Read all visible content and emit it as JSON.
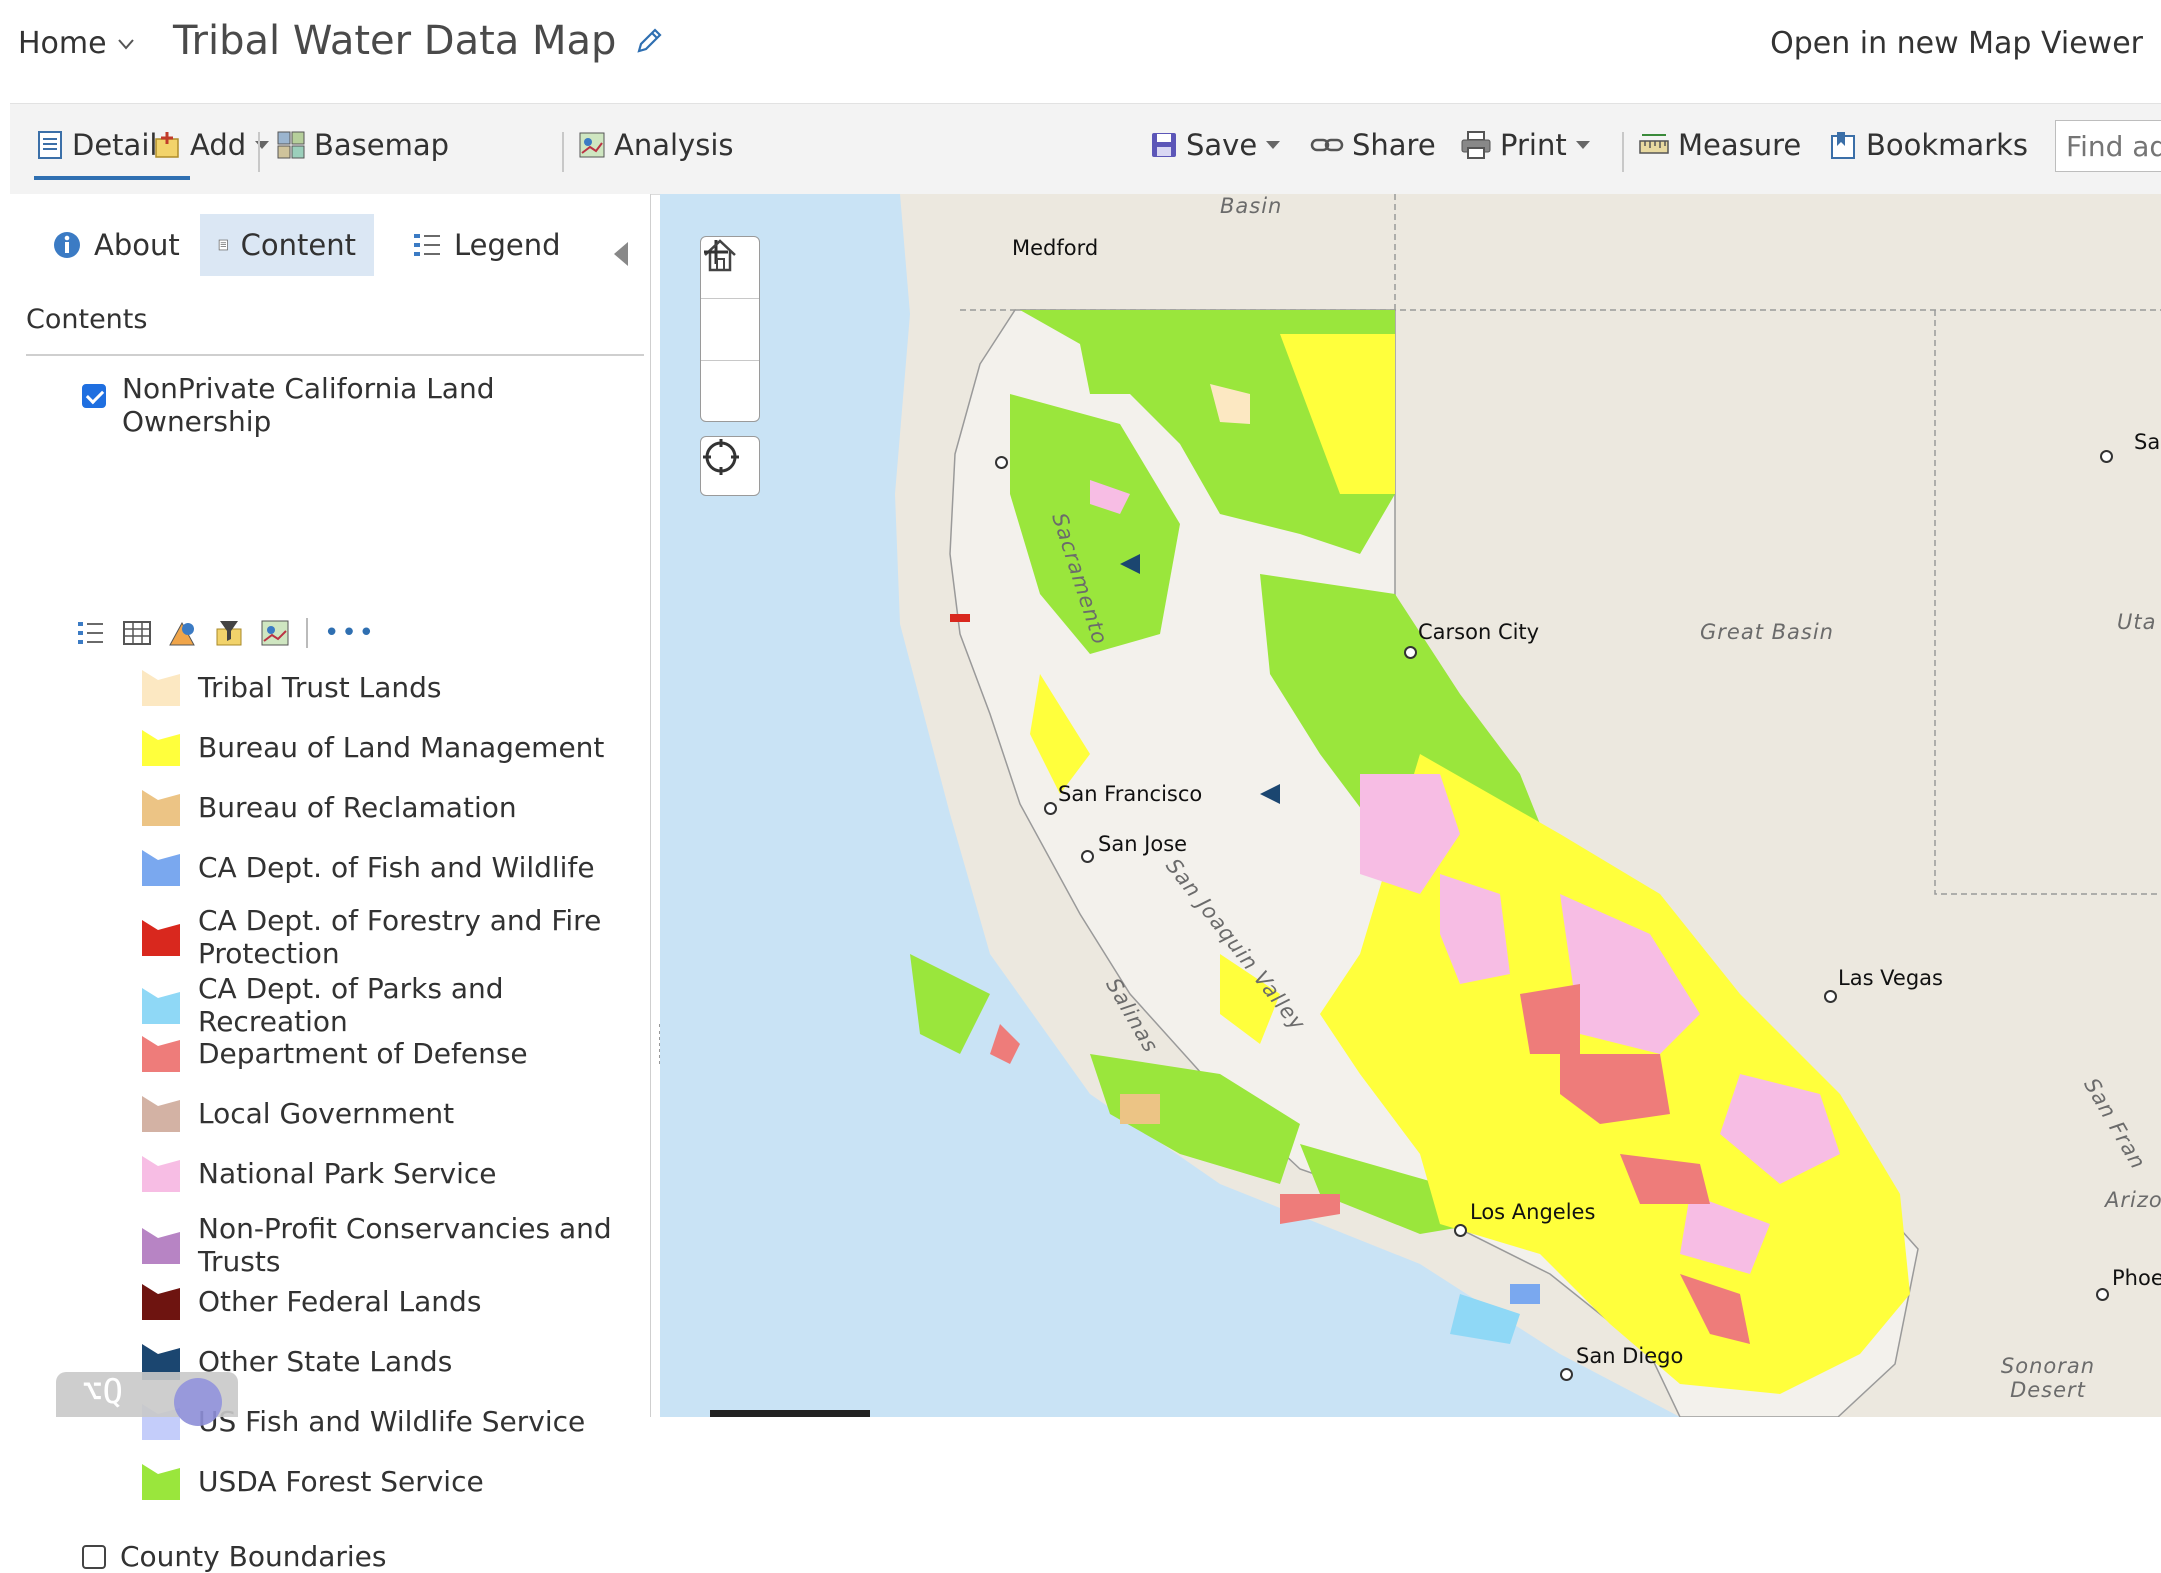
{
  "header": {
    "home_label": "Home",
    "title": "Tribal Water Data Map",
    "open_viewer_label": "Open in new Map Viewer"
  },
  "toolbar": {
    "details": "Details",
    "add": "Add",
    "basemap": "Basemap",
    "analysis": "Analysis",
    "save": "Save",
    "share": "Share",
    "print": "Print",
    "measure": "Measure",
    "bookmarks": "Bookmarks",
    "find_placeholder": "Find add"
  },
  "sidebar": {
    "tabs": [
      "About",
      "Content",
      "Legend"
    ],
    "active_tab": "Content",
    "contents_title": "Contents",
    "layers": [
      {
        "name": "NonPrivate California Land Ownership",
        "checked": true
      },
      {
        "name": "County Boundaries",
        "checked": false
      }
    ],
    "legend": [
      {
        "label": "Tribal Trust Lands",
        "color": "#fce8c2"
      },
      {
        "label": "Bureau of Land Management",
        "color": "#ffff3c"
      },
      {
        "label": "Bureau of Reclamation",
        "color": "#ecc485"
      },
      {
        "label": "CA Dept. of Fish and Wildlife",
        "color": "#7aa8ef"
      },
      {
        "label": "CA Dept. of Forestry and Fire Protection",
        "color": "#d9281e"
      },
      {
        "label": "CA Dept. of Parks and Recreation",
        "color": "#8fd8f6"
      },
      {
        "label": "Department of Defense",
        "color": "#ee7c7a"
      },
      {
        "label": "Local Government",
        "color": "#d3b2a4"
      },
      {
        "label": "National Park Service",
        "color": "#f7bde4"
      },
      {
        "label": "Non-Profit Conservancies and Trusts",
        "color": "#b784c4"
      },
      {
        "label": "Other Federal Lands",
        "color": "#6e1410"
      },
      {
        "label": "Other State Lands",
        "color": "#1b4670"
      },
      {
        "label": "US Fish and Wildlife Service",
        "color": "#c4cdfa"
      },
      {
        "label": "USDA Forest Service",
        "color": "#9ae63c"
      }
    ],
    "badge_text": "⌥Q"
  },
  "map": {
    "cities": [
      "Medford",
      "Carson City",
      "San Francisco",
      "San Jose",
      "Las Vegas",
      "Los Angeles",
      "San Diego",
      "Sal",
      "Phoe"
    ],
    "regions": [
      "Basin",
      "Great Basin",
      "Sacramento",
      "San Joaquin Valley",
      "Salinas",
      "Sonoran Desert",
      "Uta",
      "Arizo",
      "San Fran"
    ]
  }
}
